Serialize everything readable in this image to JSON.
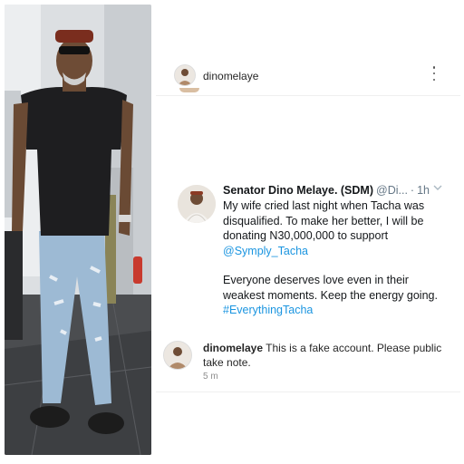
{
  "post": {
    "username": "dinomelaye"
  },
  "tweet": {
    "name": "Senator Dino Melaye. (SDM)",
    "handle": "@Di...",
    "separator": "·",
    "time": "1h",
    "line1": "My wife cried last night when Tacha was disqualified. To make her better, I will be donating N30,000,000 to support",
    "mention": "@Symply_Tacha",
    "line2": "Everyone deserves love even in their weakest moments. Keep the energy going.",
    "hashtag": "#EverythingTacha"
  },
  "comment": {
    "username": "dinomelaye",
    "text": "This is a fake account. Please public take note.",
    "time": "5 m"
  },
  "colors": {
    "link": "#1b95e0",
    "secondary_text": "#657786",
    "timestamp": "#8e8e8e",
    "divider": "#efefef"
  },
  "icons": {
    "menu": "more-vertical-icon",
    "tweet_menu": "chevron-down-icon"
  }
}
